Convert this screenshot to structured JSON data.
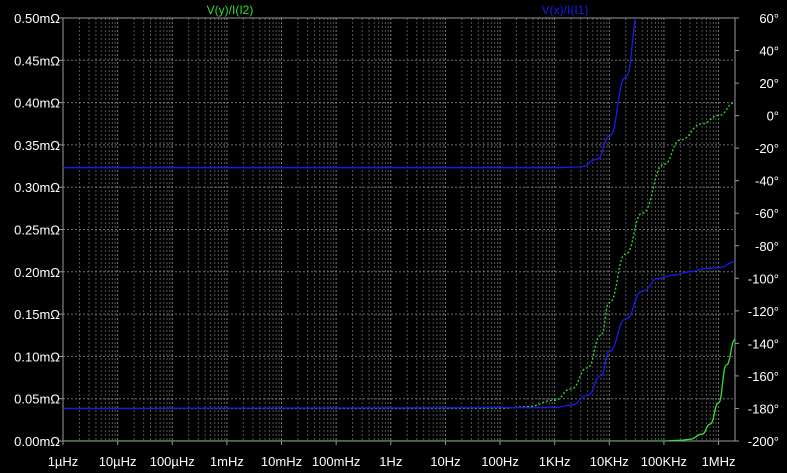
{
  "colors": {
    "background": "#000000",
    "grid": "#8a8a8a",
    "frame": "#9a9a9a",
    "text": "#ffffff"
  },
  "chart_data": {
    "type": "line",
    "x_scale": "log",
    "xlim": [
      1e-06,
      2000000
    ],
    "ylim_left": [
      0,
      0.5
    ],
    "ylim_right": [
      -200,
      60
    ],
    "x_ticks": [
      {
        "value": 1e-06,
        "label": "1µHz"
      },
      {
        "value": 1e-05,
        "label": "10µHz"
      },
      {
        "value": 0.0001,
        "label": "100µHz"
      },
      {
        "value": 0.001,
        "label": "1mHz"
      },
      {
        "value": 0.01,
        "label": "10mHz"
      },
      {
        "value": 0.1,
        "label": "100mHz"
      },
      {
        "value": 1,
        "label": "1Hz"
      },
      {
        "value": 10,
        "label": "10Hz"
      },
      {
        "value": 100,
        "label": "100Hz"
      },
      {
        "value": 1000,
        "label": "1KHz"
      },
      {
        "value": 10000,
        "label": "10KHz"
      },
      {
        "value": 100000,
        "label": "100KHz"
      },
      {
        "value": 1000000,
        "label": "1MHz"
      }
    ],
    "y_ticks_left": [
      {
        "value": 0.5,
        "label": "0.50mΩ"
      },
      {
        "value": 0.45,
        "label": "0.45mΩ"
      },
      {
        "value": 0.4,
        "label": "0.40mΩ"
      },
      {
        "value": 0.35,
        "label": "0.35mΩ"
      },
      {
        "value": 0.3,
        "label": "0.30mΩ"
      },
      {
        "value": 0.25,
        "label": "0.25mΩ"
      },
      {
        "value": 0.2,
        "label": "0.20mΩ"
      },
      {
        "value": 0.15,
        "label": "0.15mΩ"
      },
      {
        "value": 0.1,
        "label": "0.10mΩ"
      },
      {
        "value": 0.05,
        "label": "0.05mΩ"
      },
      {
        "value": 0.0,
        "label": "0.00mΩ"
      }
    ],
    "y_ticks_right": [
      {
        "value": 60,
        "label": "60°"
      },
      {
        "value": 40,
        "label": "40°"
      },
      {
        "value": 20,
        "label": "20°"
      },
      {
        "value": 0,
        "label": "0°"
      },
      {
        "value": -20,
        "label": "-20°"
      },
      {
        "value": -40,
        "label": "-40°"
      },
      {
        "value": -60,
        "label": "-60°"
      },
      {
        "value": -80,
        "label": "-80°"
      },
      {
        "value": -100,
        "label": "-100°"
      },
      {
        "value": -120,
        "label": "-120°"
      },
      {
        "value": -140,
        "label": "-140°"
      },
      {
        "value": -160,
        "label": "-160°"
      },
      {
        "value": -180,
        "label": "-180°"
      },
      {
        "value": -200,
        "label": "-200°"
      }
    ],
    "series": [
      {
        "name": "V(y)/I(I2)",
        "color": "#33dd33",
        "dash": false,
        "axis": "left",
        "points": [
          [
            1e-06,
            0.0
          ],
          [
            10000.0,
            0.0
          ],
          [
            100000.0,
            0.0
          ],
          [
            200000.0,
            0.0008
          ],
          [
            300000.0,
            0.002
          ],
          [
            500000.0,
            0.008
          ],
          [
            700000.0,
            0.02
          ],
          [
            1000000.0,
            0.045
          ],
          [
            1400000.0,
            0.09
          ],
          [
            2000000.0,
            0.12
          ]
        ]
      },
      {
        "name": "V(y)/I(I2)",
        "color": "#33dd33",
        "dash": true,
        "axis": "right",
        "points": [
          [
            1e-06,
            -180
          ],
          [
            100,
            -180
          ],
          [
            300,
            -179
          ],
          [
            1000,
            -175
          ],
          [
            2000,
            -168
          ],
          [
            4000,
            -155
          ],
          [
            7000,
            -135
          ],
          [
            10000.0,
            -115
          ],
          [
            20000.0,
            -85
          ],
          [
            40000.0,
            -60
          ],
          [
            100000.0,
            -30
          ],
          [
            200000.0,
            -15
          ],
          [
            500000.0,
            -5
          ],
          [
            1000000.0,
            0
          ],
          [
            2000000.0,
            8
          ]
        ]
      },
      {
        "name": "V(x)/I(I1)",
        "color": "#1a1aee",
        "dash": false,
        "axis": "left",
        "points": [
          [
            1e-06,
            0.323
          ],
          [
            1000,
            0.323
          ],
          [
            3000,
            0.324
          ],
          [
            6000,
            0.333
          ],
          [
            10000.0,
            0.36
          ],
          [
            20000.0,
            0.43
          ],
          [
            35000.0,
            0.51
          ]
        ]
      },
      {
        "name": "V(x)/I(I1)",
        "color": "#1a1aee",
        "dash": false,
        "axis": "right",
        "points": [
          [
            1e-06,
            -180
          ],
          [
            1000,
            -179.5
          ],
          [
            2000,
            -178
          ],
          [
            4000,
            -172
          ],
          [
            7000,
            -160
          ],
          [
            10000.0,
            -145
          ],
          [
            20000.0,
            -125
          ],
          [
            40000.0,
            -108
          ],
          [
            80000.0,
            -100
          ],
          [
            150000.0,
            -98
          ],
          [
            300000.0,
            -96
          ],
          [
            600000.0,
            -94
          ],
          [
            1000000.0,
            -93.5
          ],
          [
            2000000.0,
            -90
          ]
        ]
      }
    ],
    "legend": [
      {
        "label": "V(y)/I(I2)",
        "color": "#33dd33",
        "position": "top-left"
      },
      {
        "label": "V(x)/I(I1)",
        "color": "#1a1aee",
        "position": "top-right"
      }
    ]
  }
}
